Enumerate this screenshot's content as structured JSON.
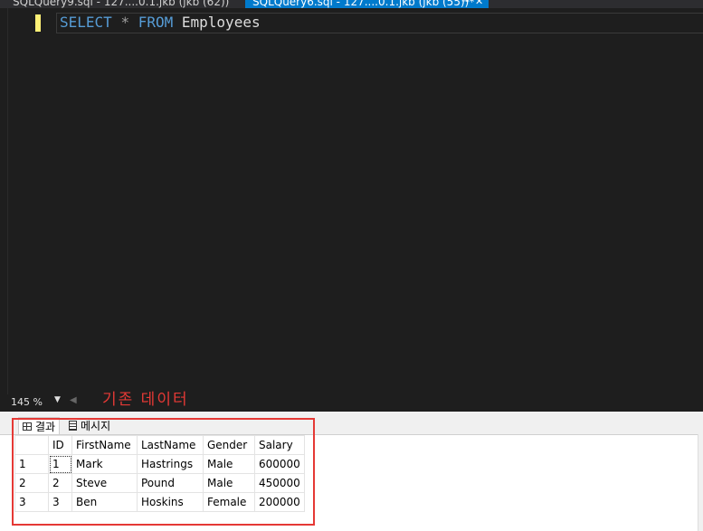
{
  "tabs": [
    {
      "label": "SQLQuery9.sql - 127....0.1.jkb (jkb (62))",
      "active": false
    },
    {
      "label": "SQLQuery6.sql - 127....0.1.jkb (jkb (55))*",
      "active": true,
      "pin": "⊸",
      "close": "✕"
    }
  ],
  "editor": {
    "kw_select": "SELECT",
    "op_star": "*",
    "kw_from": "FROM",
    "table_name": "Employees"
  },
  "zoom": {
    "level": "145 %",
    "arrow": "▼",
    "scroll_left": "◀"
  },
  "annotation": "기존 데이터",
  "result_tabs": {
    "results": "결과",
    "messages": "메시지"
  },
  "grid": {
    "columns": [
      "ID",
      "FirstName",
      "LastName",
      "Gender",
      "Salary"
    ],
    "rows": [
      {
        "n": "1",
        "id": "1",
        "first": "Mark",
        "last": "Hastrings",
        "gender": "Male",
        "salary": "600000"
      },
      {
        "n": "2",
        "id": "2",
        "first": "Steve",
        "last": "Pound",
        "gender": "Male",
        "salary": "450000"
      },
      {
        "n": "3",
        "id": "3",
        "first": "Ben",
        "last": "Hoskins",
        "gender": "Female",
        "salary": "200000"
      }
    ]
  },
  "colors": {
    "accent": "#007acc",
    "annotation": "#e53935",
    "keyword": "#569cd6"
  }
}
